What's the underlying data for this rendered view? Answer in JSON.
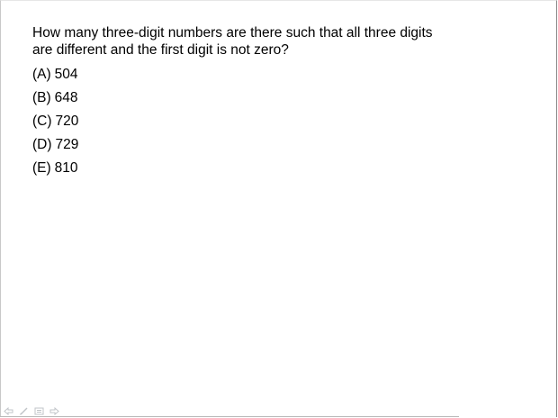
{
  "question": {
    "line1": "How many three-digit numbers are there such that all three digits",
    "line2": "are different and the first digit is not zero?"
  },
  "choices": [
    {
      "letter": "(A)",
      "value": "504"
    },
    {
      "letter": "(B)",
      "value": "648"
    },
    {
      "letter": "(C)",
      "value": "720"
    },
    {
      "letter": "(D)",
      "value": "729"
    },
    {
      "letter": "(E)",
      "value": "810"
    }
  ],
  "toolbar": {
    "icons": [
      "previous-arrow-icon",
      "pen-icon",
      "slide-menu-icon",
      "next-arrow-icon"
    ],
    "icon_color": "#c0c4c8"
  }
}
